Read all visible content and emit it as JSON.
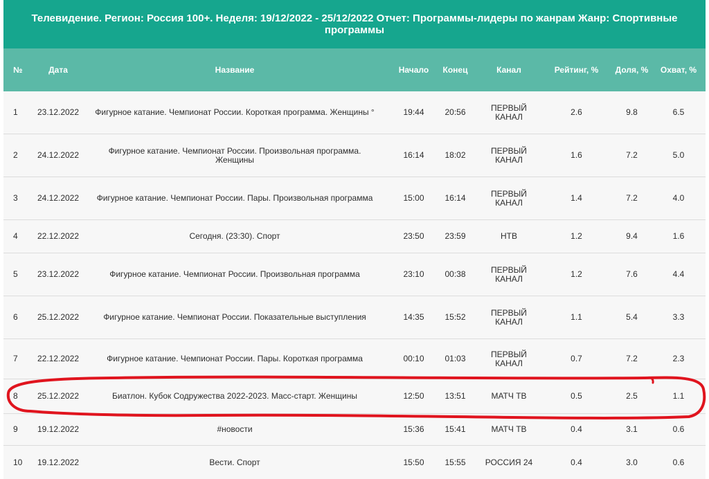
{
  "title": "Телевидение. Регион: Россия 100+. Неделя: 19/12/2022 - 25/12/2022 Отчет: Программы-лидеры по жанрам Жанр: Спортивные программы",
  "columns": {
    "num": "№",
    "date": "Дата",
    "name": "Название",
    "start": "Начало",
    "end": "Конец",
    "channel": "Канал",
    "rating": "Рейтинг, %",
    "share": "Доля, %",
    "reach": "Охват, %"
  },
  "rows": [
    {
      "num": "1",
      "date": "23.12.2022",
      "name": "Фигурное катание. Чемпионат России. Короткая программа. Женщины °",
      "start": "19:44",
      "end": "20:56",
      "channel": "ПЕРВЫЙ КАНАЛ",
      "rating": "2.6",
      "share": "9.8",
      "reach": "6.5"
    },
    {
      "num": "2",
      "date": "24.12.2022",
      "name": "Фигурное катание. Чемпионат России. Произвольная программа. Женщины",
      "start": "16:14",
      "end": "18:02",
      "channel": "ПЕРВЫЙ КАНАЛ",
      "rating": "1.6",
      "share": "7.2",
      "reach": "5.0"
    },
    {
      "num": "3",
      "date": "24.12.2022",
      "name": "Фигурное катание. Чемпионат России. Пары. Произвольная программа",
      "start": "15:00",
      "end": "16:14",
      "channel": "ПЕРВЫЙ КАНАЛ",
      "rating": "1.4",
      "share": "7.2",
      "reach": "4.0"
    },
    {
      "num": "4",
      "date": "22.12.2022",
      "name": "Сегодня. (23:30). Спорт",
      "start": "23:50",
      "end": "23:59",
      "channel": "НТВ",
      "rating": "1.2",
      "share": "9.4",
      "reach": "1.6"
    },
    {
      "num": "5",
      "date": "23.12.2022",
      "name": "Фигурное катание. Чемпионат России. Произвольная программа",
      "start": "23:10",
      "end": "00:38",
      "channel": "ПЕРВЫЙ КАНАЛ",
      "rating": "1.2",
      "share": "7.6",
      "reach": "4.4"
    },
    {
      "num": "6",
      "date": "25.12.2022",
      "name": "Фигурное катание. Чемпионат России. Показательные выступления",
      "start": "14:35",
      "end": "15:52",
      "channel": "ПЕРВЫЙ КАНАЛ",
      "rating": "1.1",
      "share": "5.4",
      "reach": "3.3"
    },
    {
      "num": "7",
      "date": "22.12.2022",
      "name": "Фигурное катание. Чемпионат России. Пары. Короткая программа",
      "start": "00:10",
      "end": "01:03",
      "channel": "ПЕРВЫЙ КАНАЛ",
      "rating": "0.7",
      "share": "7.2",
      "reach": "2.3"
    },
    {
      "num": "8",
      "date": "25.12.2022",
      "name": "Биатлон. Кубок Содружества 2022-2023. Масс-старт. Женщины",
      "start": "12:50",
      "end": "13:51",
      "channel": "МАТЧ ТВ",
      "rating": "0.5",
      "share": "2.5",
      "reach": "1.1"
    },
    {
      "num": "9",
      "date": "19.12.2022",
      "name": "#новости",
      "start": "15:36",
      "end": "15:41",
      "channel": "МАТЧ ТВ",
      "rating": "0.4",
      "share": "3.1",
      "reach": "0.6"
    },
    {
      "num": "10",
      "date": "19.12.2022",
      "name": "Вести. Спорт",
      "start": "15:50",
      "end": "15:55",
      "channel": "РОССИЯ 24",
      "rating": "0.4",
      "share": "3.0",
      "reach": "0.6"
    }
  ],
  "colors": {
    "title_bg": "#16a68e",
    "header_bg": "#5bb9a7",
    "row_bg": "#f7f7f7",
    "annotation": "#e0141e"
  }
}
